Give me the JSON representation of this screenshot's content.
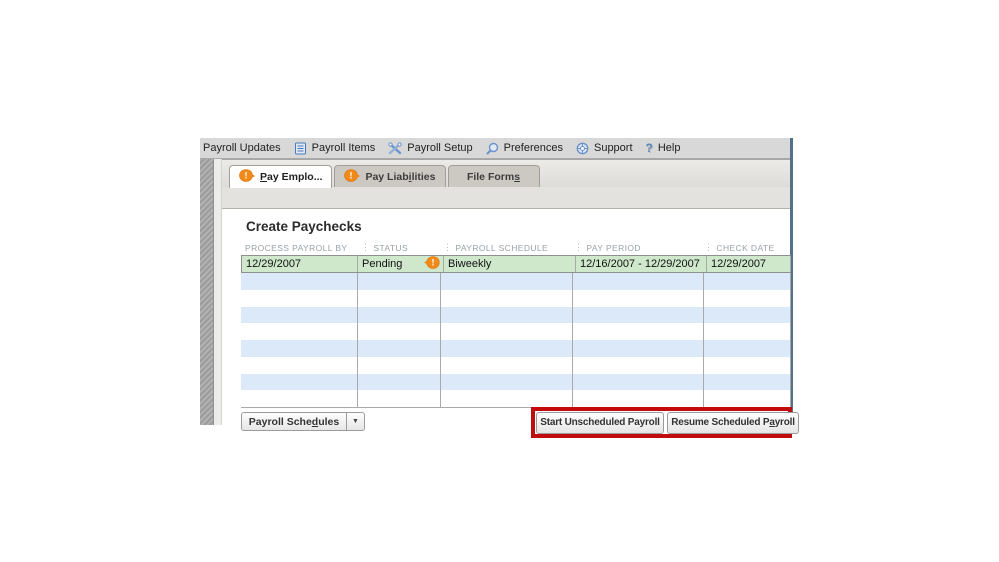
{
  "toolbar": {
    "items": [
      {
        "label": "Payroll Updates"
      },
      {
        "label": "Payroll Items"
      },
      {
        "label": "Payroll Setup"
      },
      {
        "label": "Preferences"
      },
      {
        "label": "Support"
      },
      {
        "label": "Help"
      }
    ],
    "help_glyph": "?"
  },
  "tabs": [
    {
      "pre": "",
      "mnemonic": "P",
      "post": "ay Emplo...",
      "alert": true,
      "active": true
    },
    {
      "pre": "Pay Liab",
      "mnemonic": "i",
      "post": "lities",
      "alert": true,
      "active": false
    },
    {
      "pre": "File Form",
      "mnemonic": "s",
      "post": "",
      "alert": false,
      "active": false
    }
  ],
  "page": {
    "title": "Create Paychecks"
  },
  "table": {
    "grip_char": "⋮",
    "columns": [
      "PROCESS PAYROLL BY",
      "STATUS",
      "PAYROLL SCHEDULE",
      "PAY PERIOD",
      "CHECK DATE"
    ],
    "row": {
      "process_by": "12/29/2007",
      "status": "Pending",
      "schedule": "Biweekly",
      "period": "12/16/2007 - 12/29/2007",
      "check_date": "12/29/2007"
    },
    "empty_row_count": 8
  },
  "footer": {
    "schedules": {
      "pre": "Payroll Sche",
      "mnemonic": "d",
      "post": "ules"
    },
    "dropdown_char": "▼",
    "start_label": "Start Unscheduled Payroll",
    "resume": {
      "pre": "Resume Scheduled P",
      "mnemonic": "a",
      "post": "yroll"
    }
  },
  "colors": {
    "alert_orange": "#f28a1a",
    "row_green": "#cfe8cc",
    "row_blue": "#dce9f8",
    "annotation_red": "#c00c0c",
    "window_border_blue": "#54718c"
  }
}
